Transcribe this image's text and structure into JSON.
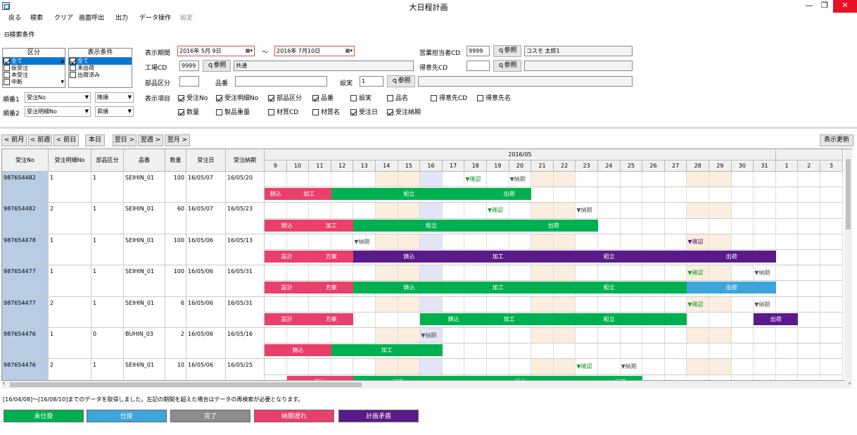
{
  "window": {
    "title": "大日程計画",
    "minimize": "—",
    "maximize": "❐",
    "close": "✕"
  },
  "menu": [
    "戻る",
    "検索",
    "クリア",
    "画面呼出",
    "出力",
    "データ操作",
    "設定"
  ],
  "search_section": {
    "toggle": "⊟検索条件"
  },
  "listbox_kubun": {
    "header": "区分",
    "items": [
      "全て",
      "仮受注",
      "本受注",
      "中断"
    ],
    "checked": [
      true,
      false,
      false,
      false
    ]
  },
  "listbox_joken": {
    "header": "表示条件",
    "items": [
      "全て",
      "未出荷",
      "出荷済み"
    ],
    "checked": [
      true,
      false,
      false
    ]
  },
  "form": {
    "period_label": "表示期間",
    "period_from": "2016年  5月  9日",
    "period_tilde": "〜",
    "period_to": "2016年  7月10日",
    "factory_label": "工場CD",
    "factory_code": "9999",
    "ref_label": "参照",
    "factory_name": "共通",
    "sales_label": "営業担当者CD",
    "sales_code": "9999",
    "sales_name": "コスモ 太郎1",
    "customer_label": "得意先CD",
    "part_label": "部品区分",
    "hinban_label": "品番",
    "setsubi_label": "設実",
    "setsubi_value": "1",
    "sort1_label": "順番1",
    "sort1_value": "受注No",
    "sort1_order": "降順",
    "sort2_label": "順番2",
    "sort2_value": "受注明細No",
    "sort2_order": "昇順",
    "display_items_label": "表示項目"
  },
  "display_items_row1": [
    {
      "label": "受注No",
      "checked": true
    },
    {
      "label": "受注明細No",
      "checked": true
    },
    {
      "label": "部品区分",
      "checked": true
    },
    {
      "label": "品番",
      "checked": true
    },
    {
      "label": "設実",
      "checked": false
    },
    {
      "label": "品名",
      "checked": false
    },
    {
      "label": "得意先CD",
      "checked": false
    },
    {
      "label": "得意先名",
      "checked": false
    }
  ],
  "display_items_row2": [
    {
      "label": "数量",
      "checked": true
    },
    {
      "label": "製品重量",
      "checked": false
    },
    {
      "label": "材質CD",
      "checked": false
    },
    {
      "label": "材質名",
      "checked": false
    },
    {
      "label": "受注日",
      "checked": true
    },
    {
      "label": "受注納期",
      "checked": true
    }
  ],
  "nav_buttons": [
    "< 前月",
    "< 前週",
    "< 前日",
    "本日",
    "翌日 >",
    "翌週 >",
    "翌月 >"
  ],
  "refresh_button": "表示更新",
  "grid": {
    "columns": [
      "受注No",
      "受注明細No",
      "部品区分",
      "品番",
      "数量",
      "受注日",
      "受注納期"
    ],
    "month_label": "2016/05",
    "days": [
      "9",
      "10",
      "11",
      "12",
      "13",
      "14",
      "15",
      "16",
      "17",
      "18",
      "19",
      "20",
      "21",
      "22",
      "23",
      "24",
      "25",
      "26",
      "27",
      "28",
      "29",
      "30",
      "31",
      "1",
      "2",
      "3"
    ],
    "rows": [
      {
        "no": "987654482",
        "meisai": "1",
        "kubun": "1",
        "hinban": "SEIHIN_01",
        "qty": "100",
        "juchu": "16/05/07",
        "noki": "16/05/20",
        "marks": [
          {
            "label": "▼確認",
            "col": 9,
            "color": "#1a9a3a"
          },
          {
            "label": "▼納期",
            "col": 11,
            "color": "#555"
          }
        ],
        "bars": [
          {
            "label": "鋳込",
            "start": 0,
            "span": 1,
            "color": "#e8406a"
          },
          {
            "label": "加工",
            "start": 1,
            "span": 2,
            "color": "#e8406a"
          },
          {
            "label": "組立",
            "start": 3,
            "span": 7,
            "color": "#00b050"
          },
          {
            "label": "出荷",
            "start": 10,
            "span": 2,
            "color": "#00b050"
          }
        ]
      },
      {
        "no": "987654482",
        "meisai": "2",
        "kubun": "1",
        "hinban": "SEIHIN_01",
        "qty": "60",
        "juchu": "16/05/07",
        "noki": "16/05/23",
        "marks": [
          {
            "label": "▼確認",
            "col": 10,
            "color": "#1a9a3a"
          },
          {
            "label": "▼納期",
            "col": 14,
            "color": "#555"
          }
        ],
        "bars": [
          {
            "label": "鋳込",
            "start": 0,
            "span": 2,
            "color": "#e8406a"
          },
          {
            "label": "加工",
            "start": 2,
            "span": 2,
            "color": "#e8406a"
          },
          {
            "label": "組立",
            "start": 4,
            "span": 7,
            "color": "#00b050"
          },
          {
            "label": "出荷",
            "start": 11,
            "span": 4,
            "color": "#00b050"
          }
        ]
      },
      {
        "no": "987654478",
        "meisai": "1",
        "kubun": "1",
        "hinban": "SEIHIN_01",
        "qty": "100",
        "juchu": "16/05/06",
        "noki": "16/05/13",
        "marks": [
          {
            "label": "▼納期",
            "col": 4,
            "color": "#555"
          },
          {
            "label": "▼確認",
            "col": 19,
            "color": "#5b1a8a"
          }
        ],
        "bars": [
          {
            "label": "設計",
            "start": 0,
            "span": 2,
            "color": "#e8406a"
          },
          {
            "label": "方案",
            "start": 2,
            "span": 2,
            "color": "#e8406a"
          },
          {
            "label": "鋳込",
            "start": 4,
            "span": 5,
            "color": "#5b1a8a"
          },
          {
            "label": "加工",
            "start": 9,
            "span": 3,
            "color": "#5b1a8a"
          },
          {
            "label": "組立",
            "start": 12,
            "span": 7,
            "color": "#5b1a8a"
          },
          {
            "label": "出荷",
            "start": 19,
            "span": 4,
            "color": "#5b1a8a"
          }
        ]
      },
      {
        "no": "987654477",
        "meisai": "1",
        "kubun": "1",
        "hinban": "SEIHIN_01",
        "qty": "100",
        "juchu": "16/05/06",
        "noki": "16/05/31",
        "marks": [
          {
            "label": "▼確認",
            "col": 19,
            "color": "#1a9a3a"
          },
          {
            "label": "▼納期",
            "col": 22,
            "color": "#555"
          }
        ],
        "bars": [
          {
            "label": "設計",
            "start": 0,
            "span": 2,
            "color": "#e8406a"
          },
          {
            "label": "方案",
            "start": 2,
            "span": 2,
            "color": "#e8406a"
          },
          {
            "label": "鋳込",
            "start": 4,
            "span": 5,
            "color": "#00b050"
          },
          {
            "label": "加工",
            "start": 9,
            "span": 3,
            "color": "#00b050"
          },
          {
            "label": "組立",
            "start": 12,
            "span": 7,
            "color": "#00b050"
          },
          {
            "label": "出荷",
            "start": 19,
            "span": 4,
            "color": "#3da5d9"
          }
        ]
      },
      {
        "no": "987654477",
        "meisai": "2",
        "kubun": "1",
        "hinban": "SEIHIN_01",
        "qty": "6",
        "juchu": "16/05/06",
        "noki": "16/05/31",
        "marks": [
          {
            "label": "▼確認",
            "col": 19,
            "color": "#1a9a3a"
          },
          {
            "label": "▼納期",
            "col": 22,
            "color": "#555"
          }
        ],
        "bars": [
          {
            "label": "設計",
            "start": 0,
            "span": 2,
            "color": "#e8406a"
          },
          {
            "label": "方案",
            "start": 2,
            "span": 2,
            "color": "#e8406a"
          },
          {
            "label": "鋳込",
            "start": 7,
            "span": 3,
            "color": "#00b050"
          },
          {
            "label": "加工",
            "start": 10,
            "span": 2,
            "color": "#00b050"
          },
          {
            "label": "組立",
            "start": 12,
            "span": 7,
            "color": "#00b050"
          },
          {
            "label": "出荷",
            "start": 22,
            "span": 2,
            "color": "#5b1a8a"
          }
        ]
      },
      {
        "no": "987654476",
        "meisai": "1",
        "kubun": "0",
        "hinban": "BUHIN_03",
        "qty": "2",
        "juchu": "16/05/06",
        "noki": "16/05/16",
        "marks": [
          {
            "label": "▼納期",
            "col": 7,
            "color": "#555"
          }
        ],
        "bars": [
          {
            "label": "鋳込",
            "start": 0,
            "span": 3,
            "color": "#e8406a"
          },
          {
            "label": "加工",
            "start": 3,
            "span": 5,
            "color": "#00b050"
          }
        ]
      },
      {
        "no": "987654476",
        "meisai": "2",
        "kubun": "1",
        "hinban": "SEIHIN_01",
        "qty": "10",
        "juchu": "16/05/06",
        "noki": "16/05/25",
        "marks": [
          {
            "label": "▼確認",
            "col": 14,
            "color": "#1a9a3a"
          },
          {
            "label": "▼納期",
            "col": 16,
            "color": "#555"
          }
        ],
        "bars": [
          {
            "label": "鋳込",
            "start": 1,
            "span": 3,
            "color": "#e8406a"
          },
          {
            "label": "加工",
            "start": 4,
            "span": 4,
            "color": "#00b050"
          },
          {
            "label": "組立",
            "start": 8,
            "span": 7,
            "color": "#00b050"
          },
          {
            "label": "出荷",
            "start": 15,
            "span": 2,
            "color": "#00b050"
          }
        ]
      }
    ]
  },
  "status_text": "[16/04/08]〜[16/08/10]までのデータを取得しました。左記の期間を超えた場合はデータの再検索が必要となります。",
  "legend": [
    {
      "label": "未仕掛",
      "color": "#00b050"
    },
    {
      "label": "仕掛",
      "color": "#3da5d9"
    },
    {
      "label": "完了",
      "color": "#8c8c8c"
    },
    {
      "label": "納期遅れ",
      "color": "#e8406a"
    },
    {
      "label": "計画矛盾",
      "color": "#5b1a8a"
    }
  ]
}
